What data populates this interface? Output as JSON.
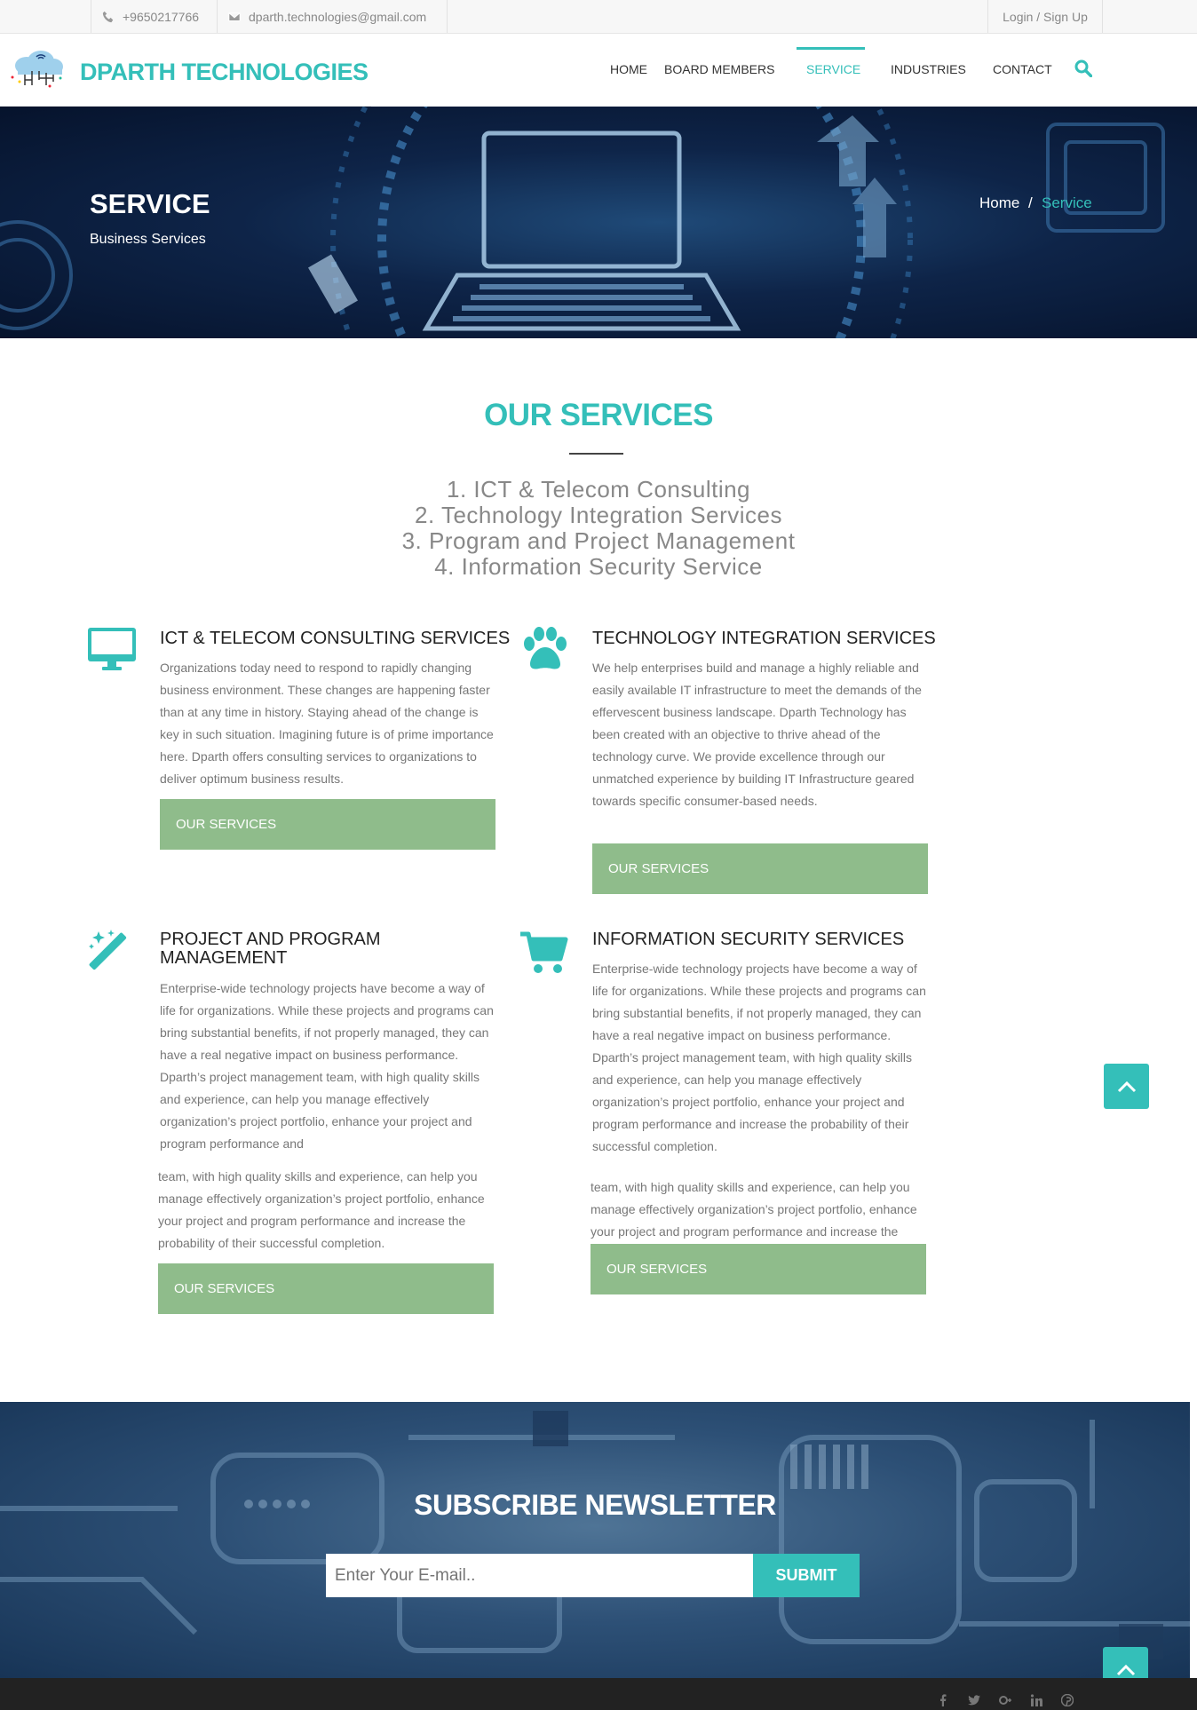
{
  "topbar": {
    "phone": "+9650217766",
    "email": "dparth.technologies@gmail.com",
    "login": "Login / Sign Up"
  },
  "header": {
    "brand": "DPARTH TECHNOLOGIES",
    "nav": [
      "HOME",
      "BOARD MEMBERS",
      "SERVICE",
      "INDUSTRIES",
      "CONTACT"
    ],
    "active_nav": "SERVICE"
  },
  "hero": {
    "title": "SERVICE",
    "subtitle": "Business Services",
    "breadcrumb": [
      "Home",
      "/",
      "Service"
    ]
  },
  "services_intro": {
    "title": "OUR SERVICES",
    "list": [
      "1. ICT & Telecom Consulting",
      "2. Technology Integration Services",
      "3. Program and Project Management",
      "4. Information Security Service"
    ]
  },
  "services": [
    {
      "icon": "monitor-icon",
      "heading": "ICT & TELECOM CONSULTING SERVICES",
      "body": "Organizations today need to respond to rapidly changing business environment. These changes are happening faster than at any time in history. Staying ahead of the change is key in such situation. Imagining future is of prime importance here. Dparth offers consulting services to organizations to deliver optimum business results.",
      "button": "OUR SERVICES"
    },
    {
      "icon": "paw-icon",
      "heading": "TECHNOLOGY INTEGRATION SERVICES",
      "body": "We help enterprises build and manage a highly reliable and easily available IT infrastructure to meet the demands of the effervescent business landscape. Dparth Technology has been created with an objective to thrive ahead of the technology curve. We provide excellence through our unmatched experience by building IT Infrastructure geared towards specific consumer-based needs.",
      "button": "OUR SERVICES"
    },
    {
      "icon": "magic-wand-icon",
      "heading": "PROJECT AND PROGRAM MANAGEMENT",
      "body": "Enterprise-wide technology projects have become a way of life for organizations. While these projects and programs can bring substantial benefits, if not properly managed, they can have a real negative impact on business performance. Dparth’s project management team, with high quality skills and experience, can help you manage effectively organization’s project portfolio, enhance your project and program performance and",
      "body_repeat": "team, with high quality skills and experience, can help you manage effectively organization’s project portfolio, enhance your project and program performance and increase the probability of their successful completion.",
      "button": "OUR SERVICES"
    },
    {
      "icon": "shopping-cart-icon",
      "heading": "INFORMATION SECURITY SERVICES",
      "body": "Enterprise-wide technology projects have become a way of life for organizations. While these projects and programs can bring substantial benefits, if not properly managed, they can have a real negative impact on business performance. Dparth’s project management team, with high quality skills and experience, can help you manage effectively organization’s project portfolio, enhance your project and program performance and increase the probability of their successful completion.",
      "body_repeat": "team, with high quality skills and experience, can help you manage effectively organization’s project portfolio, enhance your project and program performance and increase the probability of their successful completion.",
      "button": "OUR SERVICES"
    }
  ],
  "newsletter": {
    "title": "SUBSCRIBE NEWSLETTER",
    "placeholder": "Enter Your E-mail..",
    "submit": "SUBMIT"
  },
  "footer": {
    "social": [
      "facebook-icon",
      "twitter-icon",
      "google-plus-icon",
      "linkedin-icon",
      "pinterest-icon"
    ]
  },
  "colors": {
    "accent": "#34bfb9",
    "button_green": "#8fbc8b"
  }
}
